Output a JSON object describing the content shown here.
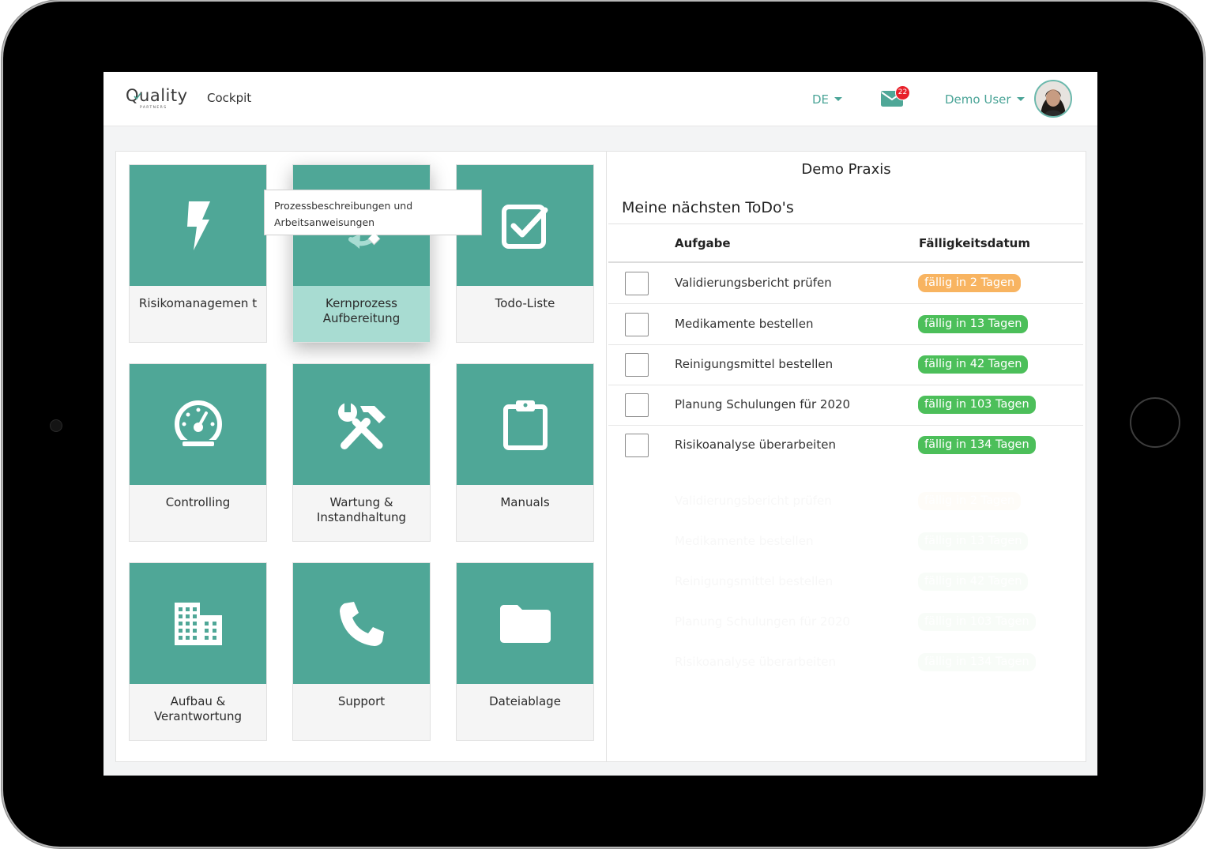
{
  "brand": {
    "logo_word": "Quality",
    "logo_sub": "PARTNERS"
  },
  "navbar": {
    "nav_item": "Cockpit",
    "language": "DE",
    "mail_count": "22",
    "user_name": "Demo User"
  },
  "tooltip": {
    "line1": "Prozessbeschreibungen und",
    "line2": "Arbeitsanweisungen"
  },
  "tiles": [
    {
      "label": "Risikomanagemen t",
      "icon": "bolt-icon"
    },
    {
      "label": "Kernprozess Aufbereitung",
      "icon": "sync-icon",
      "active": true
    },
    {
      "label": "Todo-Liste",
      "icon": "check-square-icon"
    },
    {
      "label": "Controlling",
      "icon": "gauge-icon"
    },
    {
      "label": "Wartung & Instandhaltung",
      "icon": "tools-icon"
    },
    {
      "label": "Manuals",
      "icon": "clipboard-icon"
    },
    {
      "label": "Aufbau & Verantwortung",
      "icon": "building-icon"
    },
    {
      "label": "Support",
      "icon": "phone-icon"
    },
    {
      "label": "Dateiablage",
      "icon": "folder-icon"
    }
  ],
  "todo": {
    "practice_name": "Demo Praxis",
    "title": "Meine nächsten ToDo's",
    "col_task": "Aufgabe",
    "col_due": "Fälligkeitsdatum",
    "rows": [
      {
        "task": "Validierungsbericht prüfen",
        "due": "fällig in 2 Tagen",
        "status": "warning"
      },
      {
        "task": "Medikamente bestellen",
        "due": "fällig in 13 Tagen",
        "status": "ok"
      },
      {
        "task": "Reinigungsmittel bestellen",
        "due": "fällig in 42 Tagen",
        "status": "ok"
      },
      {
        "task": "Planung Schulungen für 2020",
        "due": "fällig in 103 Tagen",
        "status": "ok"
      },
      {
        "task": "Risikoanalyse überarbeiten",
        "due": "fällig in 134 Tagen",
        "status": "ok"
      }
    ]
  },
  "colors": {
    "accent": "#4fa797",
    "accent_light": "#a8dcd2",
    "warning": "#f8b461",
    "success": "#4cbf5a",
    "badge_red": "#e8202a"
  }
}
